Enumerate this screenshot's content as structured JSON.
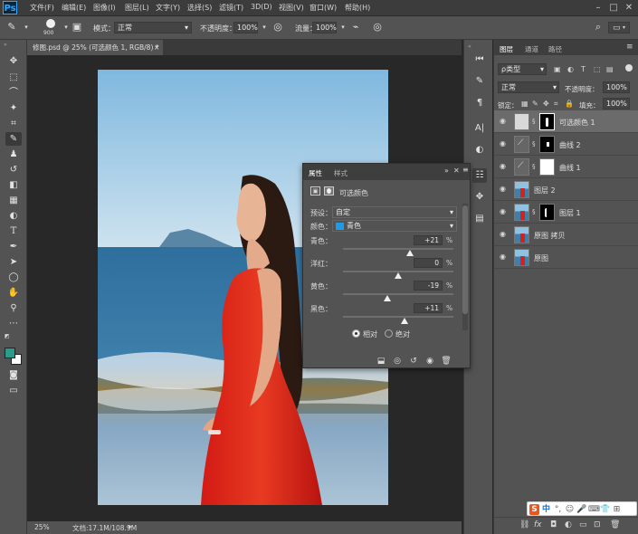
{
  "app": {
    "logo": "Ps"
  },
  "menu": [
    "文件(F)",
    "编辑(E)",
    "图像(I)",
    "图层(L)",
    "文字(Y)",
    "选择(S)",
    "滤镜(T)",
    "3D(D)",
    "视图(V)",
    "窗口(W)",
    "帮助(H)"
  ],
  "window_controls": {
    "minimize": "–",
    "maximize": "□",
    "close": "✕"
  },
  "options": {
    "brush_size": "900",
    "mode_label": "模式：",
    "mode_value": "正常",
    "opacity_label": "不透明度：",
    "opacity_value": "100%",
    "flow_label": "流量：",
    "flow_value": "100%"
  },
  "document": {
    "tab_title": "修图.psd @ 25% (可选颜色 1, RGB/8) *",
    "close": "×",
    "zoom": "25%",
    "doc_size": "文档:17.1M/108.9M"
  },
  "layers_panel": {
    "tabs": [
      "图层",
      "通道",
      "路径"
    ],
    "filter_label": "ρ类型",
    "blend_mode": "正常",
    "opacity_label": "不透明度：",
    "opacity_value": "100%",
    "lock_label": "锁定：",
    "fill_label": "填充：",
    "fill_value": "100%",
    "layers": [
      {
        "name": "可选颜色 1",
        "kind": "adjust",
        "selected": true
      },
      {
        "name": "曲线 2",
        "kind": "curves",
        "selected": false
      },
      {
        "name": "曲线 1",
        "kind": "curves",
        "selected": false
      },
      {
        "name": "图层 2",
        "kind": "photo",
        "selected": false
      },
      {
        "name": "图层 1",
        "kind": "photo-mask",
        "selected": false
      },
      {
        "name": "原图 拷贝",
        "kind": "photo",
        "selected": false
      },
      {
        "name": "原图",
        "kind": "photo",
        "selected": false
      }
    ]
  },
  "properties_panel": {
    "tabs": [
      "属性",
      "样式"
    ],
    "title": "可选颜色",
    "preset_label": "预设：",
    "preset_value": "自定",
    "color_label": "颜色：",
    "color_value": "青色",
    "color_swatch": "#1e9be8",
    "sliders": [
      {
        "label": "青色：",
        "value": "+21",
        "pos": 0.605
      },
      {
        "label": "洋红：",
        "value": "0",
        "pos": 0.5
      },
      {
        "label": "黄色：",
        "value": "-19",
        "pos": 0.405
      },
      {
        "label": "黑色：",
        "value": "+11",
        "pos": 0.555
      }
    ],
    "pct": "%",
    "method_relative": "相对",
    "method_absolute": "绝对",
    "method_selected": "相对"
  },
  "colors": {
    "foreground": "#2a9c8c",
    "background": "#ffffff"
  },
  "ime": {
    "cn_label": "中"
  }
}
